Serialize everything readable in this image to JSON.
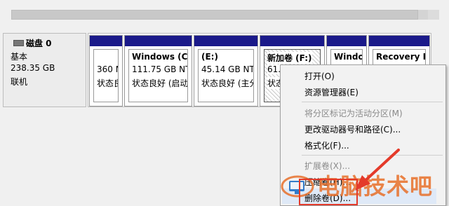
{
  "disk": {
    "name": "磁盘 0",
    "type": "基本",
    "size": "238.35 GB",
    "status": "联机"
  },
  "partitions": [
    {
      "title": "",
      "size": "360 M",
      "status": "状态良"
    },
    {
      "title": "Windows  (C:)",
      "size": "111.75 GB NTI",
      "status": "状态良好 (启动,"
    },
    {
      "title": "(E:)",
      "size": "45.14 GB NTI",
      "status": "状态良好 (主分"
    },
    {
      "title": "新加卷  (F:)",
      "size": "61.7",
      "status": "状态良"
    },
    {
      "title": "Windo",
      "size": "",
      "status": ""
    },
    {
      "title": "Recovery In",
      "size": "",
      "status": ""
    }
  ],
  "context_menu": {
    "open": "打开(O)",
    "explorer": "资源管理器(E)",
    "mark_active": "将分区标记为活动分区(M)",
    "change_letter": "更改驱动器号和路径(C)...",
    "format": "格式化(F)...",
    "extend": "扩展卷(X)...",
    "shrink": "压缩卷(H)...",
    "delete": "删除卷(D)..."
  },
  "watermark": {
    "text": "电脑技术吧",
    "color": "#e8702a"
  },
  "colors": {
    "partition_header": "#1b1a8a",
    "highlight_box": "#e43a2a"
  }
}
